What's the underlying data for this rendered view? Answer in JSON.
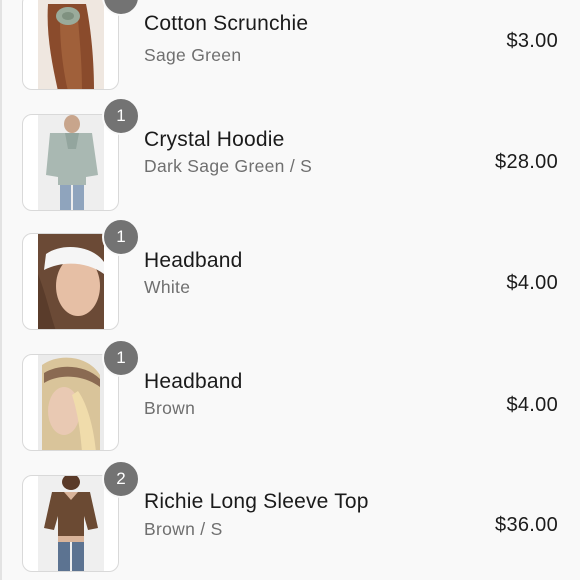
{
  "cart": {
    "items": [
      {
        "name": "Cotton Scrunchie",
        "variant": "Sage Green",
        "price": "$3.00",
        "quantity": "",
        "image_icon": "scrunchie-photo"
      },
      {
        "name": "Crystal Hoodie",
        "variant": "Dark Sage Green / S",
        "price": "$28.00",
        "quantity": "1",
        "image_icon": "hoodie-photo"
      },
      {
        "name": "Headband",
        "variant": "White",
        "price": "$4.00",
        "quantity": "1",
        "image_icon": "headband-photo"
      },
      {
        "name": "Headband",
        "variant": "Brown",
        "price": "$4.00",
        "quantity": "1",
        "image_icon": "headband-photo"
      },
      {
        "name": "Richie Long Sleeve Top",
        "variant": "Brown / S",
        "price": "$36.00",
        "quantity": "2",
        "image_icon": "top-photo"
      }
    ]
  },
  "colors": {
    "badge": "#737373",
    "text": "#1b1b1b",
    "muted": "#6f6f6f",
    "background": "#f9f9f9"
  }
}
